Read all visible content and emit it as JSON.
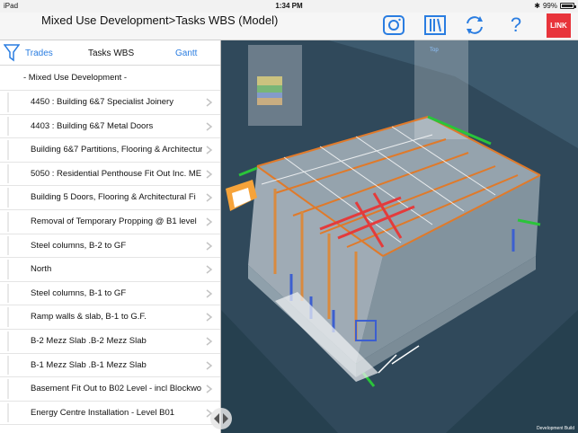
{
  "status": {
    "carrier": "iPad",
    "time": "1:34 PM",
    "battery": "99%"
  },
  "nav": {
    "title": "Mixed Use Development>Tasks WBS (Model)",
    "link_label": "LINK",
    "help_label": "?"
  },
  "tabs": {
    "trades": "Trades",
    "wbs": "Tasks WBS",
    "gantt": "Gantt"
  },
  "tree": {
    "root": "- Mixed Use Development -",
    "items": [
      "4450 : Building 6&7 Specialist Joinery",
      "4403 : Building 6&7 Metal Doors",
      "Building 6&7 Partitions, Flooring & Architectural Fi",
      "5050 : Residential Penthouse Fit Out Inc. ME",
      "Building 5 Doors, Flooring & Architectural Fi",
      "Removal of Temporary Propping @ B1 level",
      "Steel columns, B-2 to GF",
      "North",
      "Steel columns, B-1 to GF",
      "Ramp walls & slab, B-1 to G.F.",
      "B-2 Mezz Slab .B-2 Mezz Slab",
      "B-1 Mezz Slab .B-1 Mezz Slab",
      "Basement Fit Out to B02 Level - incl Blockwo",
      "Energy Centre Installation - Level B01"
    ]
  },
  "model": {
    "footer": "Development Build",
    "top_label": "Top"
  },
  "colors": {
    "accent": "#2a7de1",
    "link": "#e8343b"
  }
}
